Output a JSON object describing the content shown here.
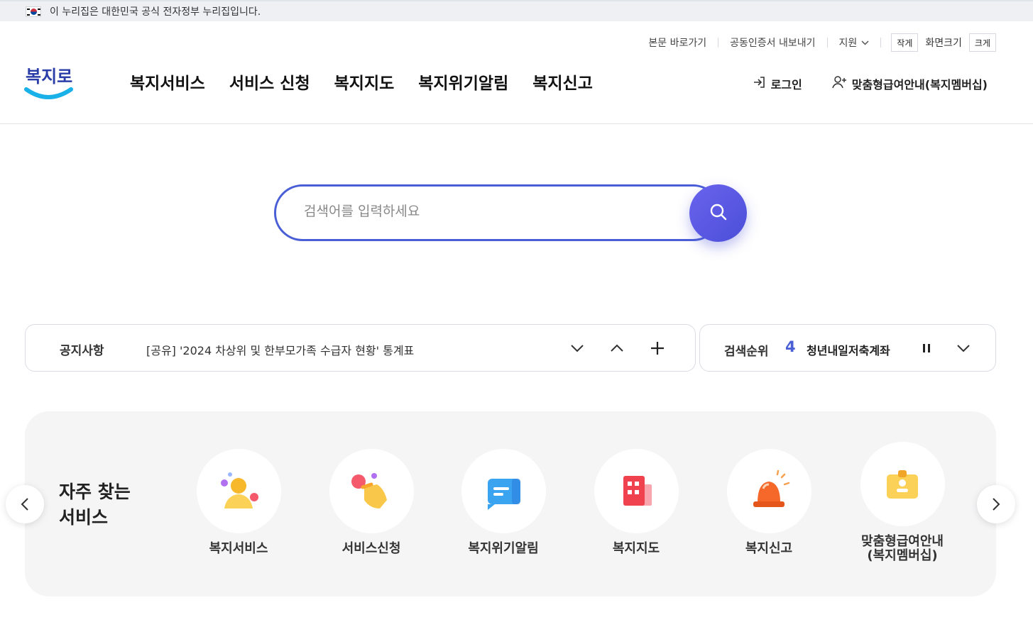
{
  "gov_banner": {
    "text": "이 누리집은 대한민국 공식 전자정부 누리집입니다."
  },
  "utility": {
    "skip_link": "본문 바로가기",
    "cert_export": "공동인증서 내보내기",
    "support": "지원",
    "font_small": "작게",
    "font_size_label": "화면크기",
    "font_large": "크게"
  },
  "logo": {
    "text": "복지로"
  },
  "gnb": [
    "복지서비스",
    "서비스 신청",
    "복지지도",
    "복지위기알림",
    "복지신고"
  ],
  "header_right": {
    "login": "로그인",
    "membership": "맞춤형급여안내(복지멤버십)"
  },
  "search": {
    "placeholder": "검색어를 입력하세요"
  },
  "notice": {
    "label": "공지사항",
    "text": "[공유] '2024 차상위 및 한부모가족 수급자 현황' 통계표"
  },
  "ranking": {
    "label": "검색순위",
    "rank": "4",
    "term": "청년내일저축계좌"
  },
  "frequent": {
    "title": "자주 찾는\n서비스",
    "items": [
      {
        "label": "복지서비스",
        "icon": "person-icon"
      },
      {
        "label": "서비스신청",
        "icon": "tap-hand-icon"
      },
      {
        "label": "복지위기알림",
        "icon": "message-icon"
      },
      {
        "label": "복지지도",
        "icon": "building-icon"
      },
      {
        "label": "복지신고",
        "icon": "siren-icon"
      },
      {
        "label": "맞춤형급여안내\n(복지멤버십)",
        "icon": "id-badge-icon"
      }
    ]
  },
  "colors": {
    "accent": "#4a5fd6",
    "panel": "#f5f5f6"
  }
}
